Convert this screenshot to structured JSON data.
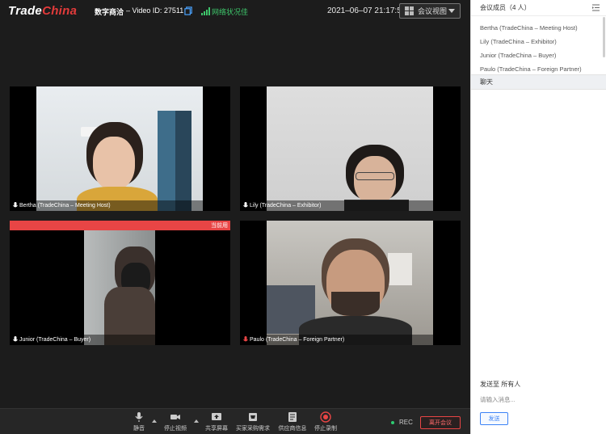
{
  "topbar": {
    "logo_part1": "Trade",
    "logo_part2": "China",
    "brand_sub": "数字商洽",
    "video_id": "– Video ID: 27511",
    "network_status": "网络状况佳",
    "datetime": "2021–06–07 21:17:55",
    "view_label": "会议视图"
  },
  "tiles": [
    {
      "caption": "Bertha (TradeChina – Meeting Host)"
    },
    {
      "caption": "Lily (TradeChina – Exhibitor)"
    },
    {
      "caption": "Junior (TradeChina – Buyer)",
      "speaking_label": "当前用"
    },
    {
      "caption": "Paulo (TradeChina – Foreign Partner)"
    }
  ],
  "toolbar": {
    "mute": "静音",
    "stop_video": "停止视频",
    "share_screen": "共享屏幕",
    "buyer_needs": "买家采购需求",
    "supplier_info": "供应商信息",
    "stop_record": "停止录制",
    "rec": "REC",
    "leave": "离开会议"
  },
  "panel": {
    "members_title": "会议成员（4 人）",
    "members": [
      "Bertha (TradeChina – Meeting Host)",
      "Lily (TradeChina – Exhibitor)",
      "Junior (TradeChina – Buyer)",
      "Paulo (TradeChina – Foreign Partner)"
    ],
    "chat_tab": "聊天",
    "send_to": "发送至  所有人",
    "input_placeholder": "请输入消息...",
    "send_label": "发送"
  },
  "colors": {
    "accent_red": "#e84545",
    "network_green": "#3ec66b",
    "link_blue": "#3b82f6"
  }
}
